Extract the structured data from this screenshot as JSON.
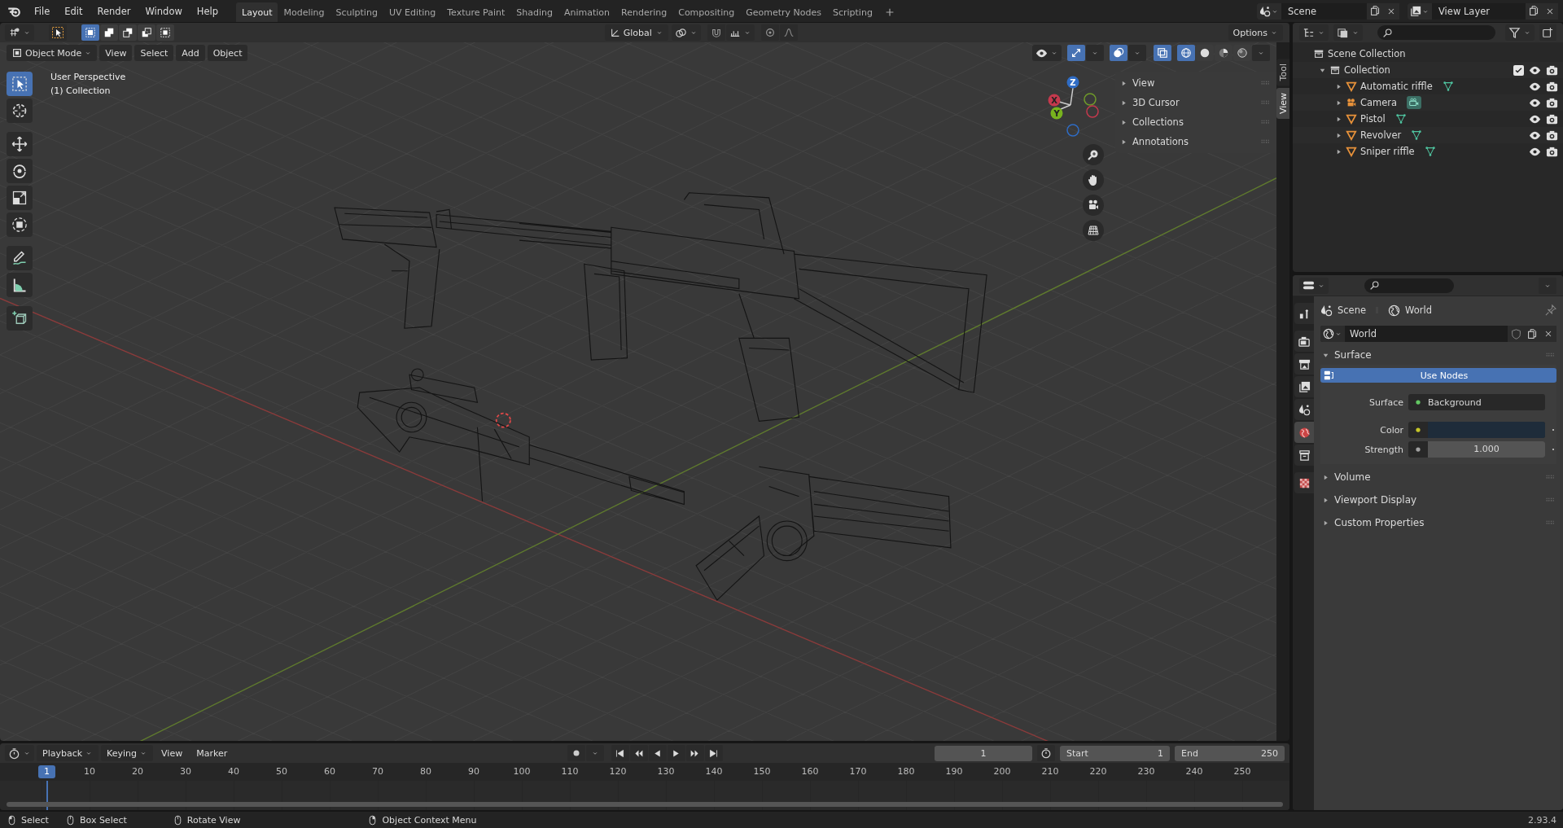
{
  "topbar": {
    "menus": [
      "File",
      "Edit",
      "Render",
      "Window",
      "Help"
    ],
    "workspaces": [
      {
        "label": "Layout",
        "selected": true
      },
      {
        "label": "Modeling",
        "selected": false
      },
      {
        "label": "Sculpting",
        "selected": false
      },
      {
        "label": "UV Editing",
        "selected": false
      },
      {
        "label": "Texture Paint",
        "selected": false
      },
      {
        "label": "Shading",
        "selected": false
      },
      {
        "label": "Animation",
        "selected": false
      },
      {
        "label": "Rendering",
        "selected": false
      },
      {
        "label": "Compositing",
        "selected": false
      },
      {
        "label": "Geometry Nodes",
        "selected": false
      },
      {
        "label": "Scripting",
        "selected": false
      }
    ],
    "scene": "Scene",
    "view_layer": "View Layer"
  },
  "tool_settings": {
    "select_modes": [
      {
        "kind": "set",
        "selected": true
      },
      {
        "kind": "extend",
        "selected": false
      },
      {
        "kind": "subtract",
        "selected": false
      },
      {
        "kind": "invert",
        "selected": false
      },
      {
        "kind": "intersect",
        "selected": false
      }
    ],
    "orientation": "Global",
    "options": "Options"
  },
  "viewport": {
    "mode": "Object Mode",
    "menus": [
      "View",
      "Select",
      "Add",
      "Object"
    ],
    "shading_modes": [
      {
        "kind": "wireframe",
        "selected": true
      },
      {
        "kind": "solid",
        "selected": false
      },
      {
        "kind": "material",
        "selected": false
      },
      {
        "kind": "rendered",
        "selected": false
      }
    ],
    "info": [
      "User Perspective",
      "(1) Collection"
    ],
    "tools": [
      {
        "kind": "select",
        "selected": true
      },
      {
        "kind": "cursor",
        "selected": false
      },
      {
        "kind": "move",
        "selected": false
      },
      {
        "kind": "rotate",
        "selected": false
      },
      {
        "kind": "scale",
        "selected": false
      },
      {
        "kind": "transform",
        "selected": false
      },
      {
        "kind": "annotate",
        "selected": false
      },
      {
        "kind": "measure",
        "selected": false
      },
      {
        "kind": "add_cube",
        "selected": false
      }
    ],
    "gizmo_axes": [
      "Z",
      "X",
      "Y"
    ],
    "sidebar": {
      "panels": [
        {
          "label": "View",
          "expanded": false
        },
        {
          "label": "3D Cursor",
          "expanded": false
        },
        {
          "label": "Collections",
          "expanded": false
        },
        {
          "label": "Annotations",
          "expanded": false
        }
      ],
      "tabs": [
        {
          "label": "Tool",
          "selected": false
        },
        {
          "label": "View",
          "selected": true
        }
      ]
    }
  },
  "outliner": {
    "tree": [
      {
        "name": "Scene Collection",
        "kind": "scene_collection",
        "children": [
          {
            "name": "Collection",
            "kind": "collection",
            "expanded": true,
            "checked": true,
            "children": [
              {
                "name": "Automatic riffle",
                "kind": "mesh",
                "expanded": false
              },
              {
                "name": "Camera",
                "kind": "camera",
                "expanded": false
              },
              {
                "name": "Pistol",
                "kind": "mesh",
                "expanded": false
              },
              {
                "name": "Revolver",
                "kind": "mesh",
                "expanded": false
              },
              {
                "name": "Sniper riffle",
                "kind": "mesh",
                "expanded": false
              }
            ]
          }
        ]
      }
    ]
  },
  "properties": {
    "tabs": [
      {
        "kind": "tool",
        "selected": false
      },
      {
        "kind": "render",
        "selected": false
      },
      {
        "kind": "output",
        "selected": false
      },
      {
        "kind": "view_layer",
        "selected": false
      },
      {
        "kind": "scene",
        "selected": false
      },
      {
        "kind": "world",
        "selected": true
      },
      {
        "kind": "collection",
        "selected": false
      },
      {
        "kind": "texture",
        "selected": false
      }
    ],
    "breadcrumb": [
      "Scene",
      "World"
    ],
    "world": "World",
    "panels": [
      {
        "label": "Surface",
        "expanded": true,
        "button": "Use Nodes",
        "fields": [
          {
            "label": "Surface",
            "kind": "shader",
            "value": "Background"
          },
          {
            "label": "Color",
            "kind": "color",
            "color": "#1e2c3a"
          },
          {
            "label": "Strength",
            "kind": "number",
            "value": "1.000"
          }
        ]
      },
      {
        "label": "Volume",
        "expanded": false
      },
      {
        "label": "Viewport Display",
        "expanded": false
      },
      {
        "label": "Custom Properties",
        "expanded": false
      }
    ]
  },
  "timeline": {
    "menus": [
      {
        "label": "Playback",
        "dropdown": true
      },
      {
        "label": "Keying",
        "dropdown": true
      },
      {
        "label": "View",
        "dropdown": false
      },
      {
        "label": "Marker",
        "dropdown": false
      }
    ],
    "current_frame": "1",
    "start_label": "Start",
    "start": "1",
    "end_label": "End",
    "end": "250",
    "playhead": "1",
    "ruler": [
      "10",
      "20",
      "30",
      "40",
      "50",
      "60",
      "70",
      "80",
      "90",
      "100",
      "110",
      "120",
      "130",
      "140",
      "150",
      "160",
      "170",
      "180",
      "190",
      "200",
      "210",
      "220",
      "230",
      "240",
      "250"
    ]
  },
  "status_bar": {
    "hints": [
      "Select",
      "Box Select",
      "Rotate View",
      "Object Context Menu"
    ],
    "version": "2.93.4"
  }
}
